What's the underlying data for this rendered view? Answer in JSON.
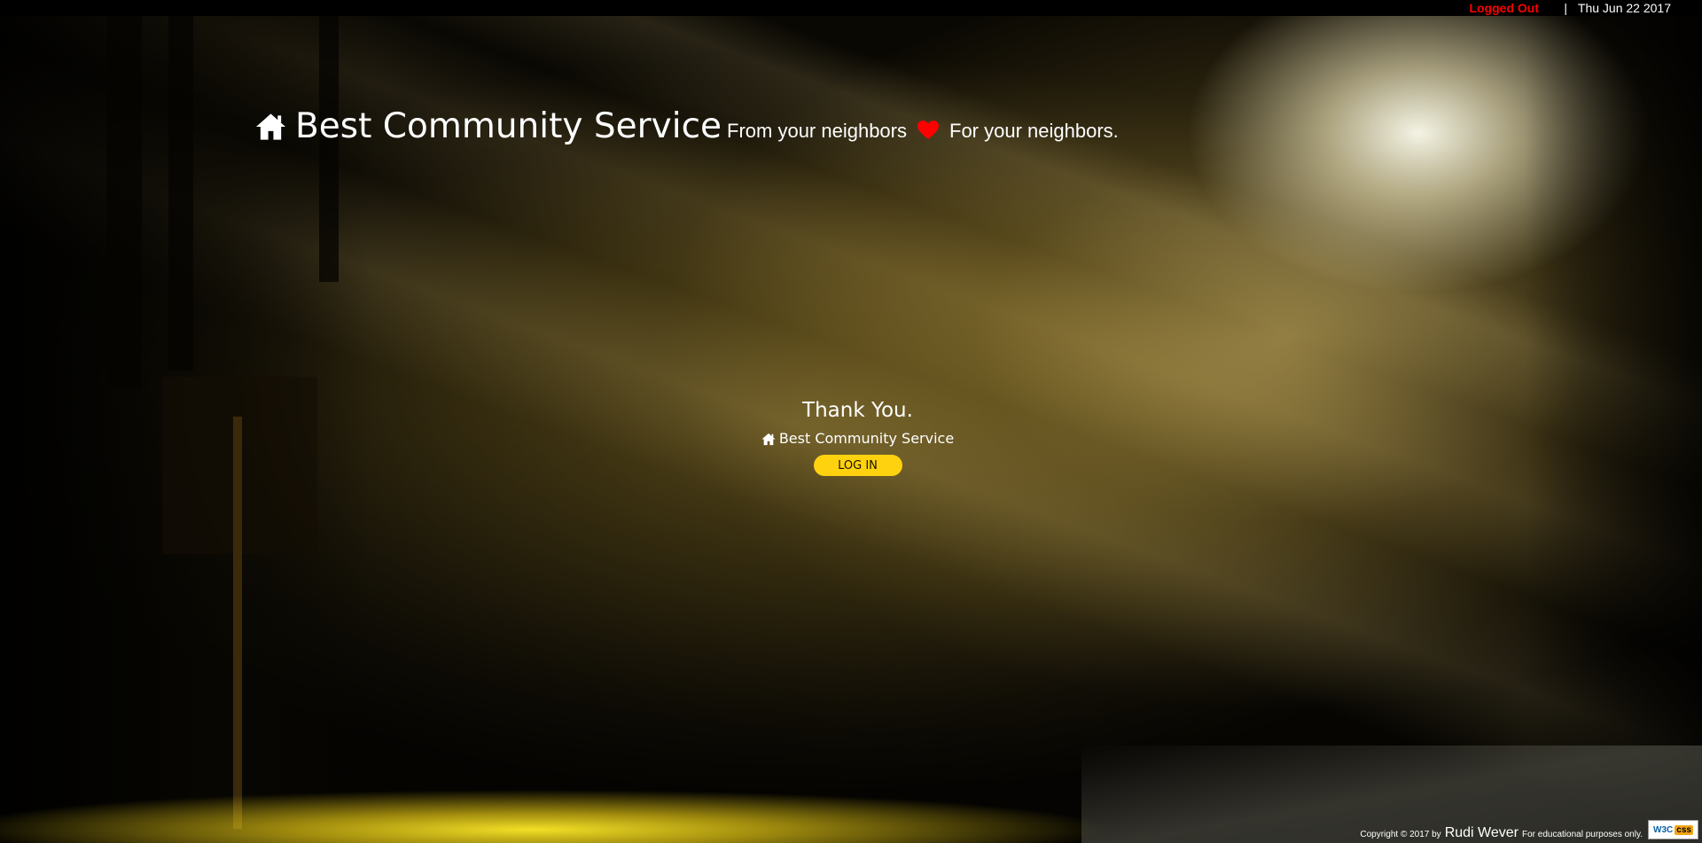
{
  "topbar": {
    "status": "Logged Out",
    "separator": "|",
    "date": "Thu Jun 22 2017",
    "status_color": "#ff0000"
  },
  "header": {
    "brand": "Best Community Service",
    "tagline_part1": "From your neighbors",
    "tagline_part2": "For your neighbors.",
    "icons": [
      "home-icon",
      "heart-icon"
    ]
  },
  "main": {
    "title": "Thank You.",
    "brand_small": "Best Community Service",
    "login_label": "LOG IN",
    "button_color": "#ffd20f"
  },
  "footer": {
    "copyright": "Copyright © 2017 by",
    "author": "Rudi Wever",
    "note": "For educational purposes only.",
    "badge_w3c": "W3C",
    "badge_css": "css"
  }
}
